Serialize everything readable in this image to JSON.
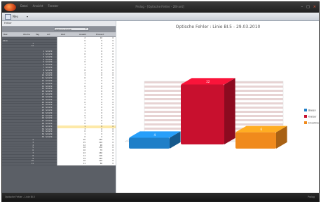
{
  "window": {
    "title": "Prolog - [Optische Fehler - 2BI-ant]",
    "menu": [
      "Datei",
      "Ansicht",
      "Fenster"
    ],
    "controls": [
      "–",
      "□",
      "×"
    ]
  },
  "toolbar": {
    "button_label": "Neu",
    "arrow": "▾"
  },
  "left_panel": {
    "header": "Fehler",
    "filter_value": "Optische Fehler",
    "columns": [
      "Bez.",
      "Woche",
      "Tag",
      "Art",
      "Zeit",
      "Anzahl",
      "Prozent"
    ],
    "rows": [
      {
        "c0": "",
        "c1": "",
        "c2": "",
        "c3": "",
        "g": [
          "",
          "2",
          "10",
          "0"
        ]
      },
      {
        "c0": "2010",
        "c1": "",
        "c2": "",
        "c3": "",
        "g": [
          "",
          "0",
          "5",
          "0"
        ]
      },
      {
        "c0": "",
        "c1": "1",
        "c2": "",
        "c3": "",
        "g": [
          "",
          "2",
          "0",
          "0"
        ]
      },
      {
        "c0": "",
        "c1": "12",
        "c2": "",
        "c3": "",
        "g": [
          "",
          "1",
          "0",
          "0"
        ]
      },
      {
        "c0": "",
        "c1": "",
        "c2": "",
        "c3": "",
        "g": [
          "",
          "0",
          "0",
          "0"
        ]
      },
      {
        "c0": "",
        "c1": "",
        "c2": "1",
        "c3": "Schicht",
        "g": [
          "",
          "1",
          "0",
          "0"
        ]
      },
      {
        "c0": "",
        "c1": "",
        "c2": "2",
        "c3": "Schicht",
        "g": [
          "",
          "0",
          "0",
          "0"
        ]
      },
      {
        "c0": "",
        "c1": "",
        "c2": "3",
        "c3": "Schicht",
        "g": [
          "",
          "2",
          "0",
          "0"
        ]
      },
      {
        "c0": "",
        "c1": "",
        "c2": "4",
        "c3": "Schicht",
        "g": [
          "",
          "1",
          "0",
          "0"
        ]
      },
      {
        "c0": "",
        "c1": "",
        "c2": "5",
        "c3": "Schicht",
        "g": [
          "",
          "0",
          "0",
          "0"
        ]
      },
      {
        "c0": "",
        "c1": "",
        "c2": "6",
        "c3": "Schicht",
        "g": [
          "",
          "3",
          "0",
          "0"
        ]
      },
      {
        "c0": "",
        "c1": "",
        "c2": "7",
        "c3": "Schicht",
        "g": [
          "",
          "1",
          "0",
          "0"
        ]
      },
      {
        "c0": "",
        "c1": "",
        "c2": "8",
        "c3": "Schicht",
        "g": [
          "",
          "0",
          "0",
          "0"
        ]
      },
      {
        "c0": "",
        "c1": "",
        "c2": "9",
        "c3": "Schicht",
        "g": [
          "",
          "2",
          "0",
          "0"
        ]
      },
      {
        "c0": "",
        "c1": "",
        "c2": "10",
        "c3": "Schicht",
        "g": [
          "",
          "1",
          "0",
          "0"
        ]
      },
      {
        "c0": "",
        "c1": "",
        "c2": "11",
        "c3": "Schicht",
        "g": [
          "",
          "0",
          "0",
          "0"
        ]
      },
      {
        "c0": "",
        "c1": "",
        "c2": "12",
        "c3": "Schicht",
        "g": [
          "",
          "1",
          "0",
          "0"
        ]
      },
      {
        "c0": "",
        "c1": "",
        "c2": "13",
        "c3": "Schicht",
        "g": [
          "",
          "2",
          "0",
          "0"
        ]
      },
      {
        "c0": "",
        "c1": "",
        "c2": "14",
        "c3": "Schicht",
        "g": [
          "",
          "0",
          "0",
          "0"
        ]
      },
      {
        "c0": "",
        "c1": "",
        "c2": "15",
        "c3": "Schicht",
        "g": [
          "",
          "1",
          "0",
          "0"
        ]
      },
      {
        "c0": "",
        "c1": "",
        "c2": "16",
        "c3": "Schicht",
        "g": [
          "",
          "3",
          "0",
          "0"
        ]
      },
      {
        "c0": "",
        "c1": "",
        "c2": "17",
        "c3": "Schicht",
        "g": [
          "",
          "0",
          "0",
          "0"
        ]
      },
      {
        "c0": "",
        "c1": "",
        "c2": "18",
        "c3": "Schicht",
        "g": [
          "",
          "1",
          "0",
          "0"
        ]
      },
      {
        "c0": "",
        "c1": "",
        "c2": "19",
        "c3": "Schicht",
        "g": [
          "",
          "2",
          "0",
          "0"
        ]
      },
      {
        "c0": "",
        "c1": "",
        "c2": "20",
        "c3": "Schicht",
        "g": [
          "",
          "0",
          "0",
          "0"
        ]
      },
      {
        "c0": "",
        "c1": "",
        "c2": "21",
        "c3": "Schicht",
        "g": [
          "",
          "1",
          "0",
          "0"
        ]
      },
      {
        "c0": "",
        "c1": "",
        "c2": "22",
        "c3": "Schicht",
        "g": [
          "",
          "0",
          "0",
          "0"
        ]
      },
      {
        "c0": "",
        "c1": "",
        "c2": "23",
        "c3": "Schicht",
        "g": [
          "",
          "2",
          "0",
          "0"
        ]
      },
      {
        "c0": "",
        "c1": "",
        "c2": "24",
        "c3": "Schicht",
        "g": [
          "",
          "1",
          "0",
          "0"
        ]
      },
      {
        "c0": "",
        "c1": "",
        "c2": "25",
        "c3": "Schicht",
        "g": [
          "",
          "0",
          "0",
          "0"
        ]
      },
      {
        "c0": "",
        "c1": "",
        "c2": "26",
        "c3": "Schicht",
        "g": [
          "",
          "1",
          "0",
          "0"
        ]
      },
      {
        "c0": "",
        "c1": "",
        "c2": "27",
        "c3": "Schicht",
        "g": [
          "",
          "2",
          "0",
          "0"
        ]
      },
      {
        "c0": "",
        "c1": "",
        "c2": "28",
        "c3": "Schicht",
        "g": [
          "",
          "0",
          "0",
          "0"
        ]
      },
      {
        "c0": "",
        "c1": "",
        "c2": "29",
        "c3": "Schicht",
        "g": [
          "",
          "1",
          "0",
          "0"
        ],
        "highlight": true
      },
      {
        "c0": "",
        "c1": "",
        "c2": "30",
        "c3": "Schicht",
        "g": [
          "",
          "3",
          "0",
          "0"
        ]
      },
      {
        "c0": "",
        "c1": "",
        "c2": "31",
        "c3": "Schicht",
        "g": [
          "",
          "0",
          "0",
          "0"
        ]
      },
      {
        "c0": "",
        "c1": "",
        "c2": "32",
        "c3": "Schicht",
        "g": [
          "",
          "1",
          "0",
          "0"
        ]
      },
      {
        "c0": "",
        "c1": "",
        "c2": "33",
        "c3": "Schicht",
        "g": [
          "",
          "0",
          "0",
          "0"
        ]
      },
      {
        "c0": "",
        "c1": "2",
        "c2": "",
        "c3": "",
        "g": [
          "",
          "20",
          "150",
          "0"
        ]
      },
      {
        "c0": "",
        "c1": "3",
        "c2": "",
        "c3": "",
        "g": [
          "",
          "15",
          "110",
          "0"
        ]
      },
      {
        "c0": "",
        "c1": "4",
        "c2": "",
        "c3": "",
        "g": [
          "",
          "12",
          "90",
          "0"
        ]
      },
      {
        "c0": "",
        "c1": "5",
        "c2": "",
        "c3": "",
        "g": [
          "",
          "18",
          "130",
          "0"
        ]
      },
      {
        "c0": "",
        "c1": "6",
        "c2": "",
        "c3": "",
        "g": [
          "",
          "10",
          "70",
          "0"
        ]
      },
      {
        "c0": "",
        "c1": "7",
        "c2": "",
        "c3": "",
        "g": [
          "",
          "22",
          "160",
          "0"
        ]
      },
      {
        "c0": "",
        "c1": "8",
        "c2": "",
        "c3": "",
        "g": [
          "",
          "14",
          "100",
          "0"
        ]
      },
      {
        "c0": "",
        "c1": "9",
        "c2": "",
        "c3": "",
        "g": [
          "",
          "19",
          "140",
          "0"
        ]
      },
      {
        "c0": "",
        "c1": "10",
        "c2": "",
        "c3": "",
        "g": [
          "",
          "16",
          "120",
          "0"
        ]
      },
      {
        "c0": "",
        "c1": "11",
        "c2": "",
        "c3": "",
        "g": [
          "",
          "11",
          "80",
          "0"
        ]
      }
    ]
  },
  "chart_data": {
    "type": "bar",
    "title": "Optische Fehler : Linie BI.5 - 29.03.2010",
    "categories": [
      "Blasen",
      "Kratzer",
      "Einschlüsse"
    ],
    "series": [
      {
        "name": "Blasen",
        "values": [
          4
        ],
        "color": "#1f7fc8"
      },
      {
        "name": "Kratzer",
        "values": [
          22
        ],
        "color": "#c8102e"
      },
      {
        "name": "Einschlüsse",
        "values": [
          6
        ],
        "color": "#f08a1c"
      }
    ],
    "data_labels": [
      "4",
      "22",
      "6"
    ],
    "ylim": [
      0,
      25
    ],
    "grid": true,
    "legend_position": "right"
  },
  "statusbar": {
    "left": "Optische Fehler - Linie BI.5",
    "right": "Prolog"
  }
}
